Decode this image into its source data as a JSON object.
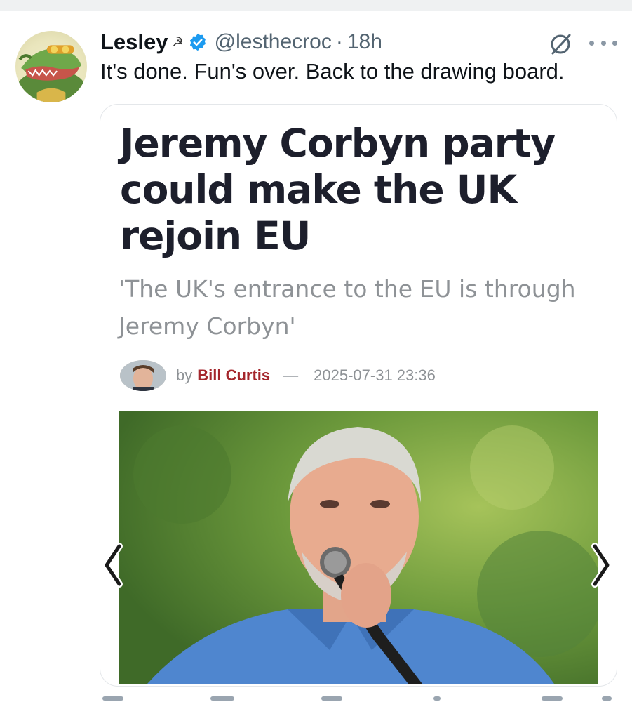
{
  "tweet": {
    "display_name": "Lesley",
    "name_emoji": "☭",
    "handle": "@lesthecroc",
    "separator": "·",
    "timestamp": "18h",
    "text": "It's done. Fun's over. Back to the drawing board.",
    "verified": true
  },
  "card": {
    "headline": "Jeremy Corbyn party could make the UK rejoin EU",
    "subtitle": "'The UK's entrance to the EU is through Jeremy Corbyn'",
    "by_label": "by",
    "author": "Bill Curtis",
    "dash": "—",
    "datetime": "2025-07-31 23:36"
  },
  "icons": {
    "verified": "verified-badge-icon",
    "grok": "grok-icon",
    "more": "more-icon",
    "prev": "chevron-left-icon",
    "next": "chevron-right-icon"
  },
  "colors": {
    "verified_blue": "#1d9bf0",
    "author_red": "#a4262c",
    "headline": "#1d1f2c",
    "muted": "#536471"
  }
}
